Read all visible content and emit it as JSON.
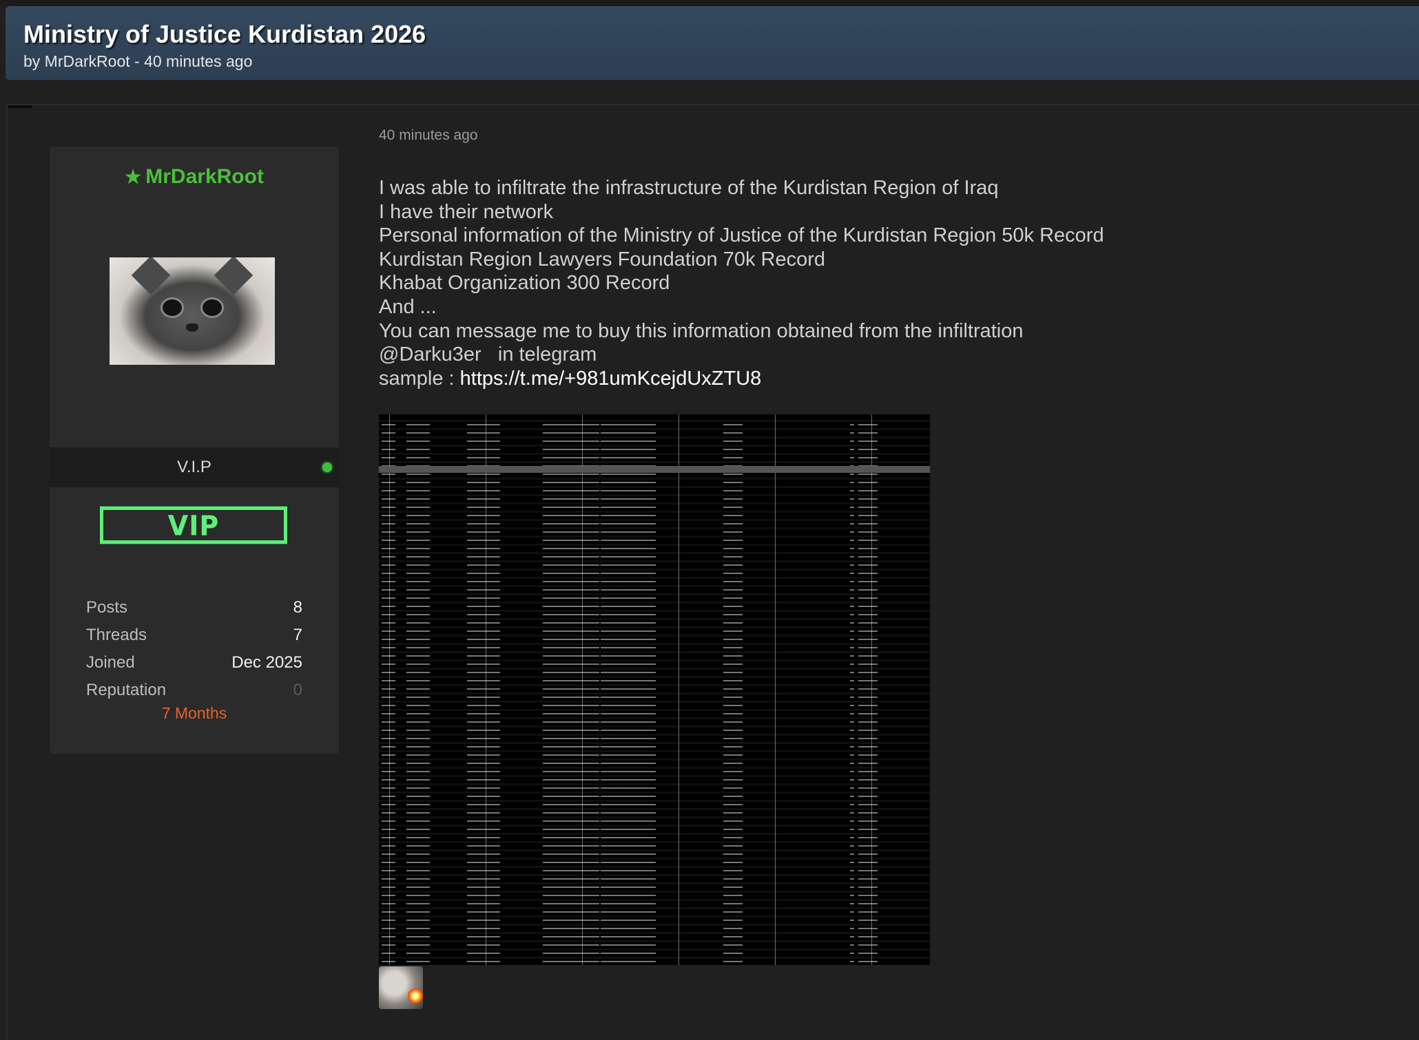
{
  "thread": {
    "title": "Ministry of Justice Kurdistan 2026",
    "byline": "by MrDarkRoot - 40 minutes ago"
  },
  "user": {
    "username": "MrDarkRoot",
    "username_color": "#4cbf3c",
    "rank": "V.I.P",
    "status_color": "#3fbf3f",
    "badge_text": "VIP",
    "stats": [
      {
        "label": "Posts",
        "value": "8"
      },
      {
        "label": "Threads",
        "value": "7"
      },
      {
        "label": "Joined",
        "value": "Dec 2025"
      },
      {
        "label": "Reputation",
        "value": "0"
      }
    ],
    "membership": "7 Months"
  },
  "post": {
    "time": "40 minutes ago",
    "lines": [
      "I was able to infiltrate the infrastructure of the Kurdistan Region of Iraq",
      "I have their network",
      "Personal information of the Ministry of Justice of the Kurdistan Region 50k Record",
      "Kurdistan Region Lawyers Foundation 70k Record",
      "Khabat Organization 300 Record",
      "And ...",
      "You can message me to buy this information obtained from the infiltration",
      "@Darku3er   in telegram"
    ],
    "sample_label": "sample : ",
    "sample_link": "https://t.me/+981umKcejdUxZTU8"
  }
}
